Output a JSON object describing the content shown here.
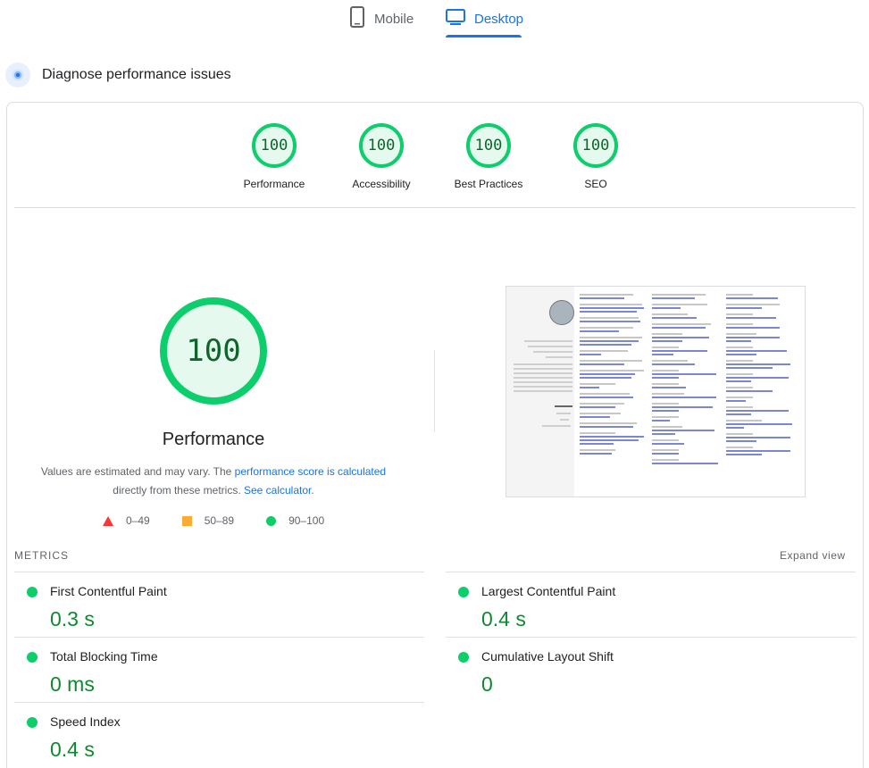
{
  "tabs": {
    "mobile": "Mobile",
    "desktop": "Desktop"
  },
  "diagnose": {
    "title": "Diagnose performance issues"
  },
  "categories": [
    {
      "score": "100",
      "label": "Performance"
    },
    {
      "score": "100",
      "label": "Accessibility"
    },
    {
      "score": "100",
      "label": "Best Practices"
    },
    {
      "score": "100",
      "label": "SEO"
    }
  ],
  "performance": {
    "score": "100",
    "title": "Performance",
    "desc_prefix": "Values are estimated and may vary. The ",
    "desc_link1": "performance score is calculated",
    "desc_middle": " directly from these metrics. ",
    "desc_link2": "See calculator",
    "desc_suffix": "."
  },
  "legend": {
    "fail": "0–49",
    "average": "50–89",
    "pass": "90–100"
  },
  "metrics": {
    "heading": "METRICS",
    "expand": "Expand view",
    "fcp": {
      "name": "First Contentful Paint",
      "value": "0.3 s"
    },
    "lcp": {
      "name": "Largest Contentful Paint",
      "value": "0.4 s"
    },
    "tbt": {
      "name": "Total Blocking Time",
      "value": "0 ms"
    },
    "cls": {
      "name": "Cumulative Layout Shift",
      "value": "0"
    },
    "si": {
      "name": "Speed Index",
      "value": "0.4 s"
    }
  },
  "colors": {
    "pass": "#0cce6b",
    "average": "#ffaa33",
    "fail": "#ff3333",
    "accent": "#1a73e8"
  },
  "icons": [
    "mobile-phone-icon",
    "desktop-monitor-icon",
    "diagnose-icon"
  ]
}
